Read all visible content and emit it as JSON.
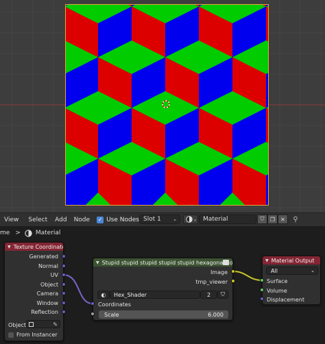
{
  "header": {
    "menu": [
      {
        "id": "view",
        "label": "View"
      },
      {
        "id": "select",
        "label": "Select"
      },
      {
        "id": "add",
        "label": "Add"
      },
      {
        "id": "node",
        "label": "Node"
      }
    ],
    "use_nodes": {
      "label": "Use Nodes",
      "checked": true
    },
    "slot": "Slot 1",
    "material_name": "Material",
    "breadcrumb": {
      "left": "me",
      "separator": ">",
      "material": "Material"
    }
  },
  "nodes": {
    "texture_coordinate": {
      "title": "Texture Coordinate",
      "header_color": "#832533",
      "outputs": [
        "Generated",
        "Normal",
        "UV",
        "Object",
        "Camera",
        "Window",
        "Reflection"
      ],
      "object_label": "Object:",
      "from_instancer": "From Instancer"
    },
    "group": {
      "title": "Stupid stupid stupid stupid stupid hexagonal color",
      "header_color": "#3b5231",
      "outputs": [
        "Image",
        "tmp_viewer"
      ],
      "node_tree": "Hex_Shader",
      "users": "2",
      "inputs": {
        "coordinates": "Coordinates",
        "scale_label": "Scale",
        "scale_value": "6.000"
      }
    },
    "material_output": {
      "title": "Material Output",
      "header_color": "#832533",
      "target": "All",
      "inputs": [
        "Surface",
        "Volume",
        "Displacement"
      ]
    }
  },
  "colors": {
    "pattern_red": "#dd0000",
    "pattern_green": "#00cc00",
    "pattern_blue": "#0000ee",
    "shader_socket": "#63c763",
    "vector_socket": "#6363c7",
    "color_socket": "#c7c729",
    "float_socket": "#a1a1a1",
    "wire_uv": "#7a66c8",
    "wire_image": "#c7c729"
  }
}
